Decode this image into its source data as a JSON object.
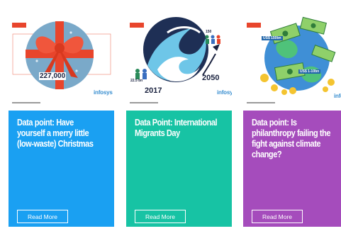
{
  "cards": [
    {
      "title": "Data point: Have yourself a merry little (low-waste) Christmas",
      "button_label": "Read More",
      "image": {
        "stat": "227,000",
        "brand": "infosys"
      },
      "panel_color": "#1aa0f2"
    },
    {
      "title": "Data Point: International Migrants Day",
      "button_label": "Read More",
      "image": {
        "year_start": "2017",
        "year_end": "2050",
        "stat_start": "22.5 bn",
        "stat_end": "150",
        "brand": "infosys"
      },
      "panel_color": "#17c3a4"
    },
    {
      "title": "Data point: Is philanthropy failing the fight against climate change?",
      "button_label": "Read More",
      "image": {
        "stat_1": "US$ 150bn",
        "stat_2": "US$ 1-10bn",
        "brand": "infosys"
      },
      "panel_color": "#a54cbc"
    }
  ]
}
